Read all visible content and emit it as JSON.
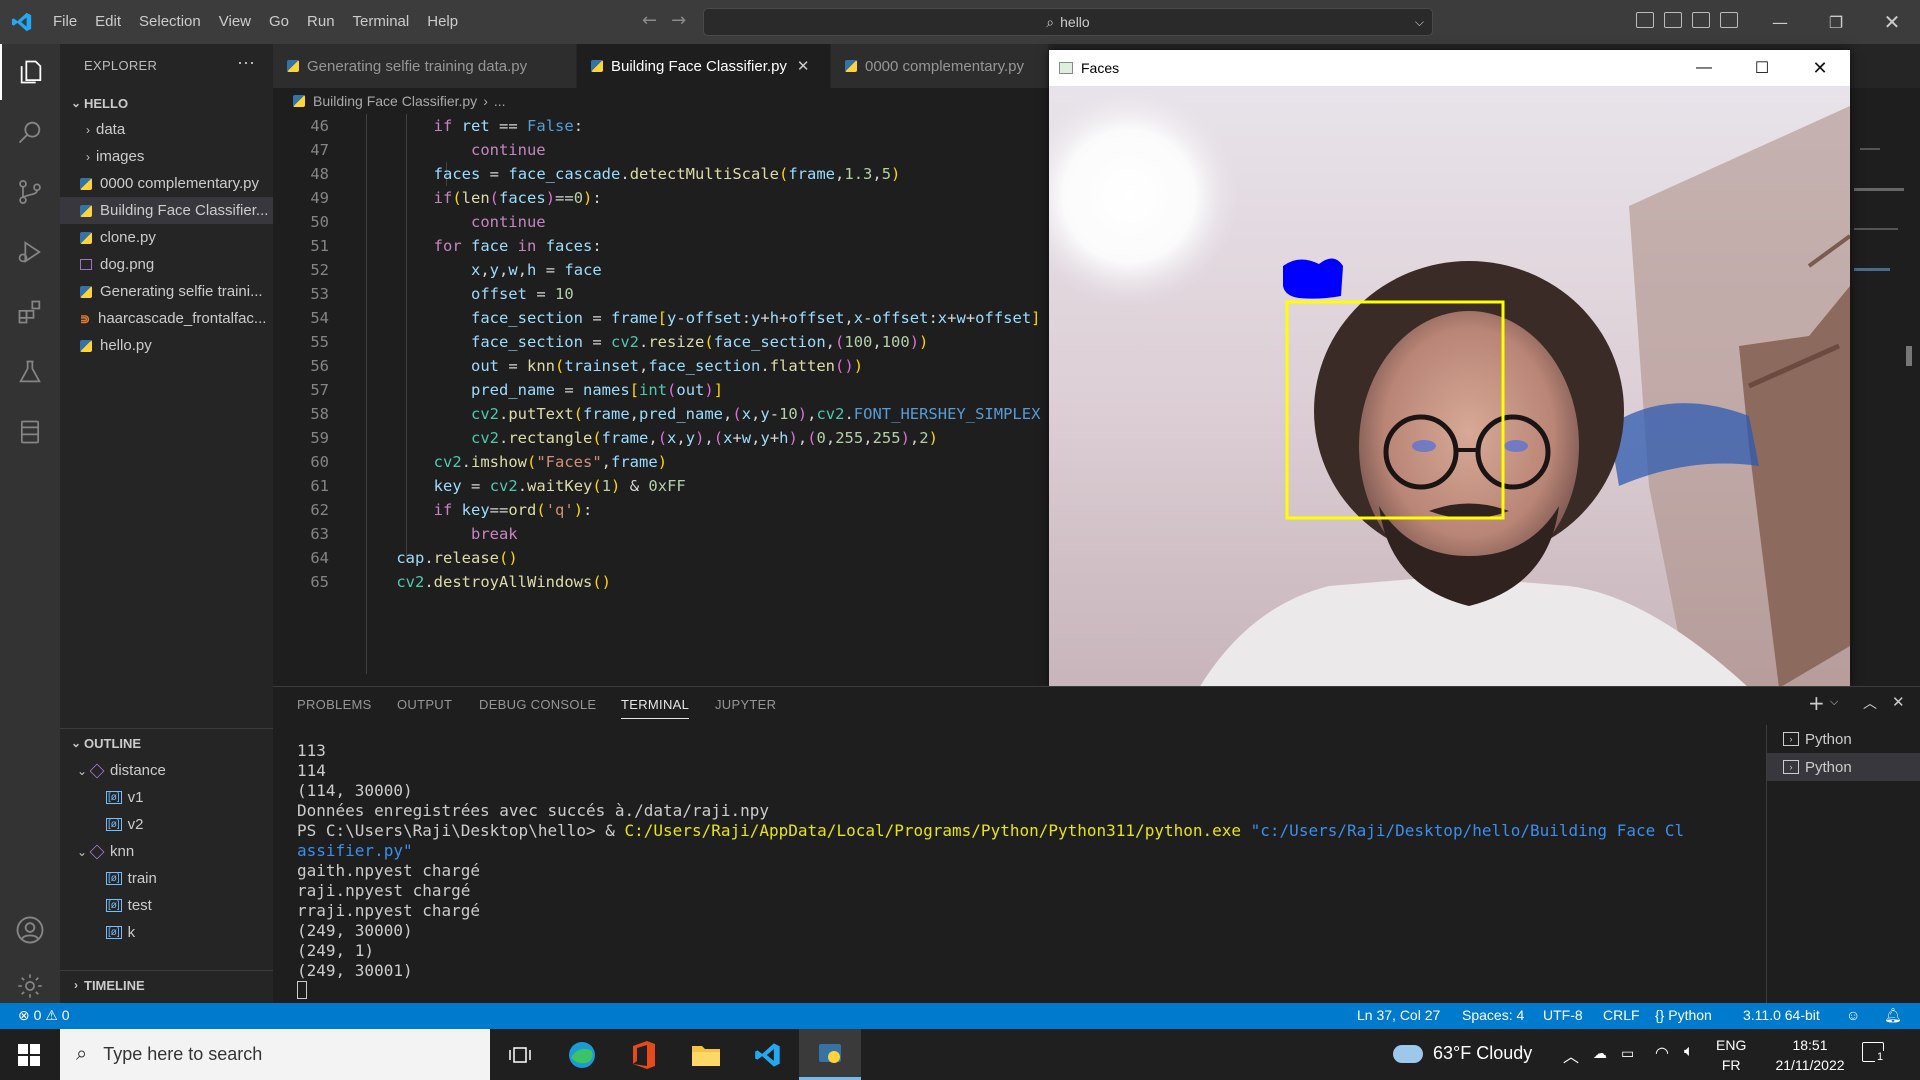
{
  "titlebar": {
    "menu": [
      "File",
      "Edit",
      "Selection",
      "View",
      "Go",
      "Run",
      "Terminal",
      "Help"
    ],
    "search_text": "hello"
  },
  "explorer": {
    "title": "EXPLORER",
    "folder": "HELLO",
    "items": [
      {
        "label": "data",
        "kind": "folder"
      },
      {
        "label": "images",
        "kind": "folder"
      },
      {
        "label": "0000 complementary.py",
        "kind": "py"
      },
      {
        "label": "Building Face Classifier...",
        "kind": "py"
      },
      {
        "label": "clone.py",
        "kind": "py"
      },
      {
        "label": "dog.png",
        "kind": "img"
      },
      {
        "label": "Generating selfie traini...",
        "kind": "py"
      },
      {
        "label": "haarcascade_frontalfac...",
        "kind": "xml"
      },
      {
        "label": "hello.py",
        "kind": "py"
      }
    ],
    "outline_title": "OUTLINE",
    "outline": [
      {
        "label": "distance",
        "kind": "fn"
      },
      {
        "label": "v1",
        "kind": "var"
      },
      {
        "label": "v2",
        "kind": "var"
      },
      {
        "label": "knn",
        "kind": "fn"
      },
      {
        "label": "train",
        "kind": "var"
      },
      {
        "label": "test",
        "kind": "var"
      },
      {
        "label": "k",
        "kind": "var"
      }
    ],
    "timeline_title": "TIMELINE"
  },
  "tabs": [
    {
      "label": "Generating selfie training data.py"
    },
    {
      "label": "Building Face Classifier.py"
    },
    {
      "label": "0000 complementary.py"
    }
  ],
  "breadcrumb": {
    "file": "Building Face Classifier.py",
    "rest": "..."
  },
  "code": {
    "line_numbers": [
      "46",
      "47",
      "48",
      "49",
      "50",
      "51",
      "52",
      "53",
      "54",
      "55",
      "56",
      "57",
      "58",
      "59",
      "60",
      "61",
      "62",
      "63",
      "64",
      "65"
    ]
  },
  "faces_window": {
    "title": "Faces"
  },
  "panel": {
    "tabs": [
      "PROBLEMS",
      "OUTPUT",
      "DEBUG CONSOLE",
      "TERMINAL",
      "JUPYTER"
    ],
    "terminal_lines": [
      "113",
      "114",
      "(114, 30000)",
      "Données enregistrées avec succés à./data/raji.npy"
    ],
    "ps_prompt": "PS C:\\Users\\Raji\\Desktop\\hello> & ",
    "ps_exe": "C:/Users/Raji/AppData/Local/Programs/Python/Python311/python.exe",
    "ps_script_1": " \"c:/Users/Raji/Desktop/hello/Building Face Cl",
    "ps_script_2": "assifier.py\"",
    "after_lines": [
      "gaith.npyest chargé",
      "raji.npyest chargé",
      "rraji.npyest chargé",
      "(249, 30000)",
      "(249, 1)",
      "(249, 30001)"
    ],
    "terminals": [
      "Python",
      "Python"
    ]
  },
  "statusbar": {
    "errors": "0",
    "warnings": "0",
    "position": "Ln 37, Col 27",
    "spaces": "Spaces: 4",
    "encoding": "UTF-8",
    "eol": "CRLF",
    "language": "Python",
    "interpreter": "3.11.0 64-bit"
  },
  "taskbar": {
    "search_placeholder": "Type here to search",
    "weather": "63°F  Cloudy",
    "lang_top": "ENG",
    "lang_bottom": "FR",
    "time": "18:51",
    "date": "21/11/2022",
    "notifications": "1"
  },
  "colors": {
    "accent": "#007acc",
    "yellow_box": "#ffff00",
    "blue_label": "#0000ff"
  }
}
